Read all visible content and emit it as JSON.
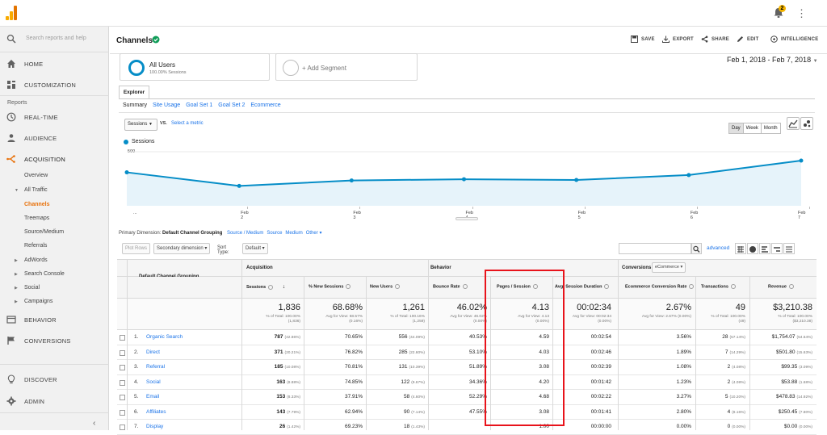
{
  "topbar": {
    "notification_count": "2"
  },
  "sidebar": {
    "search_placeholder": "Search reports and help",
    "home": "HOME",
    "customization": "CUSTOMIZATION",
    "reports_label": "Reports",
    "realtime": "REAL-TIME",
    "audience": "AUDIENCE",
    "acquisition": "ACQUISITION",
    "overview": "Overview",
    "all_traffic": "All Traffic",
    "channels": "Channels",
    "treemaps": "Treemaps",
    "source_medium": "Source/Medium",
    "referrals": "Referrals",
    "adwords": "AdWords",
    "search_console": "Search Console",
    "social": "Social",
    "campaigns": "Campaigns",
    "behavior": "BEHAVIOR",
    "conversions": "CONVERSIONS",
    "discover": "DISCOVER",
    "admin": "ADMIN"
  },
  "header": {
    "title": "Channels",
    "save": "SAVE",
    "export": "EXPORT",
    "share": "SHARE",
    "edit": "EDIT",
    "intelligence": "INTELLIGENCE"
  },
  "segments": {
    "name": "All Users",
    "sub": "100.00% Sessions",
    "add": "+ Add Segment"
  },
  "date_range": "Feb 1, 2018 - Feb 7, 2018",
  "tabs": {
    "explorer": "Explorer",
    "sub": [
      "Summary",
      "Site Usage",
      "Goal Set 1",
      "Goal Set 2",
      "Ecommerce"
    ]
  },
  "chart_controls": {
    "metric": "Sessions",
    "vs": "VS.",
    "select_metric": "Select a metric",
    "day": "Day",
    "week": "Week",
    "month": "Month"
  },
  "chart_data": {
    "type": "line",
    "series": [
      {
        "name": "Sessions",
        "values": [
          310,
          235,
          265,
          272,
          268,
          295,
          375
        ]
      }
    ],
    "x": [
      "...",
      "Feb 2",
      "Feb 3",
      "Feb 4",
      "Feb 5",
      "Feb 6",
      "Feb 7"
    ],
    "yticks": [
      "500",
      "250"
    ],
    "ylim": [
      0,
      500
    ],
    "color": "#058dc7"
  },
  "dimension": {
    "label": "Primary Dimension:",
    "current": "Default Channel Grouping",
    "options": [
      "Source / Medium",
      "Source",
      "Medium",
      "Other ▾"
    ]
  },
  "table_controls": {
    "plot_rows": "Plot Rows",
    "secondary": "Secondary dimension ▾",
    "sort_type_label": "Sort Type:",
    "sort_type": "Default ▾",
    "advanced": "advanced"
  },
  "table": {
    "dimension_header": "Default Channel Grouping",
    "groups": {
      "acquisition": "Acquisition",
      "behavior": "Behavior",
      "conversions": "Conversions",
      "conversion_select": "eCommerce ▾"
    },
    "columns": [
      "Sessions",
      "% New Sessions",
      "New Users",
      "Bounce Rate",
      "Pages / Session",
      "Avg. Session Duration",
      "Ecommerce Conversion Rate",
      "Transactions",
      "Revenue"
    ],
    "sort_arrow": "↓",
    "totals": {
      "values": [
        "1,836",
        "68.68%",
        "1,261",
        "46.02%",
        "4.13",
        "00:02:34",
        "2.67%",
        "49",
        "$3,210.38"
      ],
      "subs": [
        [
          "% of Total: 100.00%",
          "(1,836)"
        ],
        [
          "Avg for View: 68.57%",
          "(0.16%)"
        ],
        [
          "% of Total: 100.16%",
          "(1,259)"
        ],
        [
          "Avg for View: 46.02%",
          "(0.00%)"
        ],
        [
          "Avg for View: 4.13",
          "(0.00%)"
        ],
        [
          "Avg for View: 00:02:34",
          "(0.00%)"
        ],
        [
          "Avg for View: 2.67% (0.00%)",
          ""
        ],
        [
          "% of Total: 100.00%",
          "(49)"
        ],
        [
          "% of Total: 100.00%",
          "($3,210.38)"
        ]
      ]
    },
    "rows": [
      {
        "n": "1.",
        "name": "Organic Search",
        "sessions": "787",
        "sessions_pct": "(42.86%)",
        "new_sess": "70.65%",
        "new_users": "556",
        "new_users_pct": "(44.09%)",
        "bounce": "40.53%",
        "pps": "4.59",
        "dur": "00:02:54",
        "conv": "3.56%",
        "trans": "28",
        "trans_pct": "(57.14%)",
        "rev": "$1,754.07",
        "rev_pct": "(54.64%)"
      },
      {
        "n": "2.",
        "name": "Direct",
        "sessions": "371",
        "sessions_pct": "(20.21%)",
        "new_sess": "76.82%",
        "new_users": "285",
        "new_users_pct": "(22.60%)",
        "bounce": "53.10%",
        "pps": "4.03",
        "dur": "00:02:46",
        "conv": "1.89%",
        "trans": "7",
        "trans_pct": "(14.29%)",
        "rev": "$501.80",
        "rev_pct": "(15.63%)"
      },
      {
        "n": "3.",
        "name": "Referral",
        "sessions": "185",
        "sessions_pct": "(10.08%)",
        "new_sess": "70.81%",
        "new_users": "131",
        "new_users_pct": "(10.39%)",
        "bounce": "51.89%",
        "pps": "3.08",
        "dur": "00:02:39",
        "conv": "1.08%",
        "trans": "2",
        "trans_pct": "(4.08%)",
        "rev": "$99.35",
        "rev_pct": "(3.09%)"
      },
      {
        "n": "4.",
        "name": "Social",
        "sessions": "163",
        "sessions_pct": "(8.88%)",
        "new_sess": "74.85%",
        "new_users": "122",
        "new_users_pct": "(9.67%)",
        "bounce": "34.36%",
        "pps": "4.20",
        "dur": "00:01:42",
        "conv": "1.23%",
        "trans": "2",
        "trans_pct": "(4.08%)",
        "rev": "$53.88",
        "rev_pct": "(1.68%)"
      },
      {
        "n": "5.",
        "name": "Email",
        "sessions": "153",
        "sessions_pct": "(8.33%)",
        "new_sess": "37.91%",
        "new_users": "58",
        "new_users_pct": "(4.60%)",
        "bounce": "52.29%",
        "pps": "4.68",
        "dur": "00:02:22",
        "conv": "3.27%",
        "trans": "5",
        "trans_pct": "(10.20%)",
        "rev": "$478.83",
        "rev_pct": "(14.92%)"
      },
      {
        "n": "6.",
        "name": "Affiliates",
        "sessions": "143",
        "sessions_pct": "(7.79%)",
        "new_sess": "62.94%",
        "new_users": "90",
        "new_users_pct": "(7.14%)",
        "bounce": "47.55%",
        "pps": "3.08",
        "dur": "00:01:41",
        "conv": "2.80%",
        "trans": "4",
        "trans_pct": "(8.16%)",
        "rev": "$250.45",
        "rev_pct": "(7.80%)"
      },
      {
        "n": "7.",
        "name": "Display",
        "sessions": "26",
        "sessions_pct": "(1.42%)",
        "new_sess": "69.23%",
        "new_users": "18",
        "new_users_pct": "(1.43%)",
        "bounce": "",
        "pps": "1.00",
        "dur": "00:00:00",
        "conv": "0.00%",
        "trans": "0",
        "trans_pct": "(0.00%)",
        "rev": "$0.00",
        "rev_pct": "(0.00%)"
      }
    ]
  }
}
